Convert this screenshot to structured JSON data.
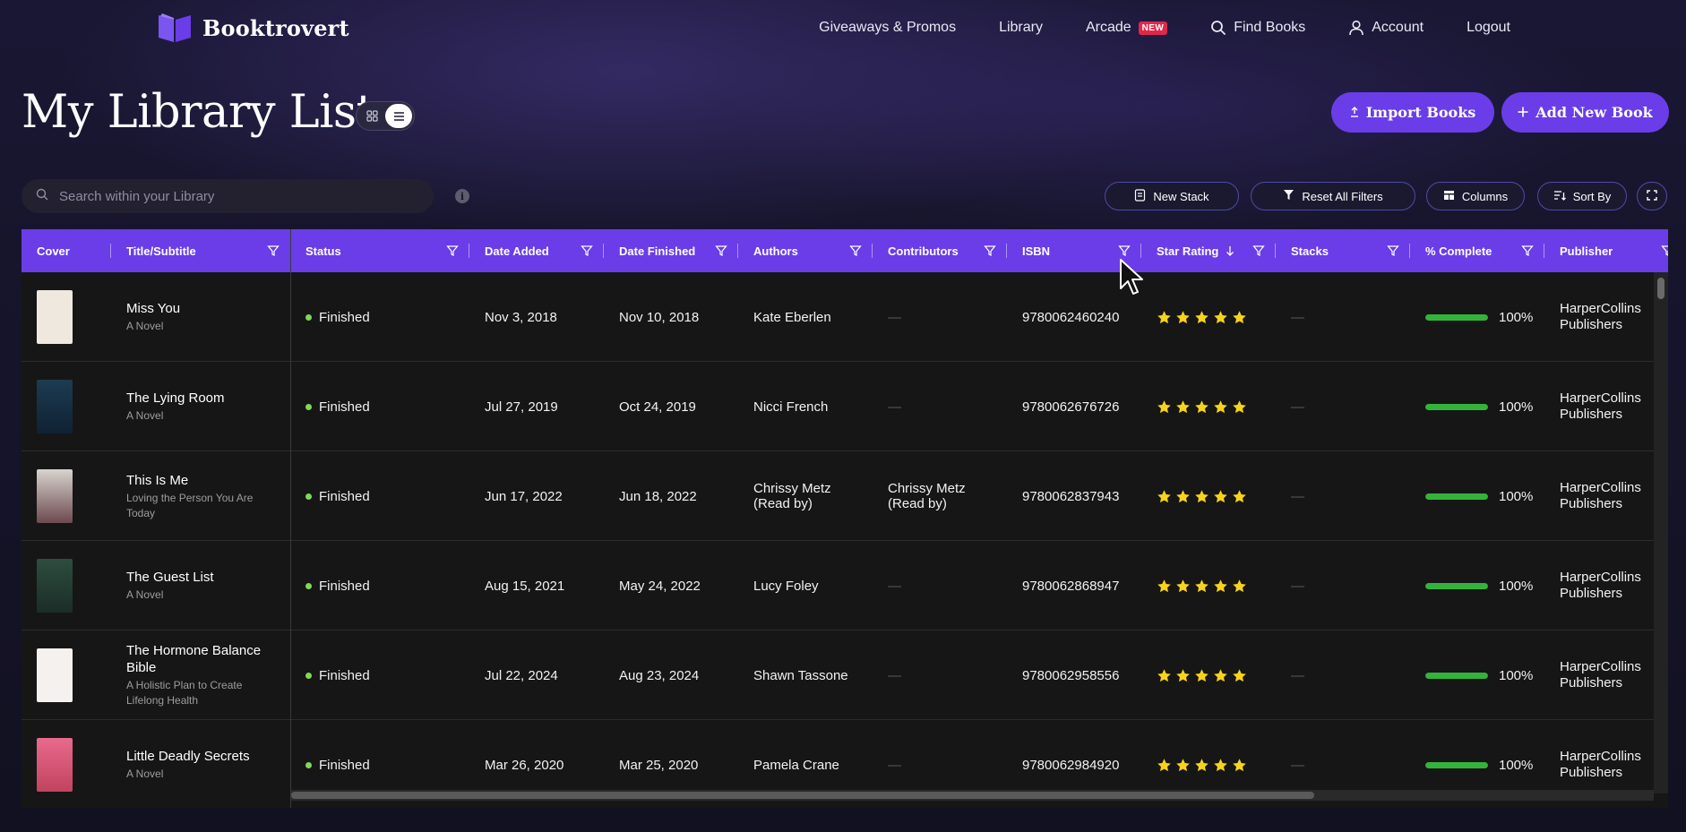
{
  "brand": {
    "name": "Booktrovert"
  },
  "nav": {
    "links": [
      {
        "label": "Giveaways & Promos"
      },
      {
        "label": "Library"
      },
      {
        "label": "Arcade",
        "badge": "NEW"
      },
      {
        "label": "Find Books",
        "icon": "search-icon"
      },
      {
        "label": "Account",
        "icon": "user-icon"
      },
      {
        "label": "Logout"
      }
    ]
  },
  "page": {
    "title": "My Library List"
  },
  "actions": {
    "import_label": "Import Books",
    "add_label": "Add New Book"
  },
  "search": {
    "placeholder": "Search within your Library"
  },
  "toolbar": {
    "new_stack": "New Stack",
    "reset_filters": "Reset All Filters",
    "columns": "Columns",
    "sort_by": "Sort By"
  },
  "colors": {
    "accent": "#6a3de8",
    "finished": "#7ed957",
    "progress": "#34b33b",
    "star": "#f7d31b",
    "badge": "#e0274a"
  },
  "table": {
    "columns": [
      "Cover",
      "Title/Subtitle",
      "Status",
      "Date Added",
      "Date Finished",
      "Authors",
      "Contributors",
      "ISBN",
      "Star Rating",
      "Stacks",
      "% Complete",
      "Publisher"
    ],
    "sorted_column": "Star Rating",
    "rows": [
      {
        "title": "Miss You",
        "subtitle": "A Novel",
        "status": "Finished",
        "date_added": "Nov 3, 2018",
        "date_finished": "Nov 10, 2018",
        "authors": "Kate Eberlen",
        "contributors": "—",
        "isbn": "9780062460240",
        "rating": 5,
        "stacks": "—",
        "complete": 100,
        "complete_label": "100%",
        "publisher": "HarperCollins Publishers"
      },
      {
        "title": "The Lying Room",
        "subtitle": "A Novel",
        "status": "Finished",
        "date_added": "Jul 27, 2019",
        "date_finished": "Oct 24, 2019",
        "authors": "Nicci French",
        "contributors": "—",
        "isbn": "9780062676726",
        "rating": 5,
        "stacks": "—",
        "complete": 100,
        "complete_label": "100%",
        "publisher": "HarperCollins Publishers"
      },
      {
        "title": "This Is Me",
        "subtitle": "Loving the Person You Are Today",
        "status": "Finished",
        "date_added": "Jun 17, 2022",
        "date_finished": "Jun 18, 2022",
        "authors": "Chrissy Metz (Read by)",
        "contributors": "Chrissy Metz (Read by)",
        "isbn": "9780062837943",
        "rating": 5,
        "stacks": "—",
        "complete": 100,
        "complete_label": "100%",
        "publisher": "HarperCollins Publishers"
      },
      {
        "title": "The Guest List",
        "subtitle": "A Novel",
        "status": "Finished",
        "date_added": "Aug 15, 2021",
        "date_finished": "May 24, 2022",
        "authors": "Lucy Foley",
        "contributors": "—",
        "isbn": "9780062868947",
        "rating": 5,
        "stacks": "—",
        "complete": 100,
        "complete_label": "100%",
        "publisher": "HarperCollins Publishers"
      },
      {
        "title": "The Hormone Balance Bible",
        "subtitle": "A Holistic Plan to Create Lifelong Health",
        "status": "Finished",
        "date_added": "Jul 22, 2024",
        "date_finished": "Aug 23, 2024",
        "authors": "Shawn Tassone",
        "contributors": "—",
        "isbn": "9780062958556",
        "rating": 5,
        "stacks": "—",
        "complete": 100,
        "complete_label": "100%",
        "publisher": "HarperCollins Publishers"
      },
      {
        "title": "Little Deadly Secrets",
        "subtitle": "A Novel",
        "status": "Finished",
        "date_added": "Mar 26, 2020",
        "date_finished": "Mar 25, 2020",
        "authors": "Pamela Crane",
        "contributors": "—",
        "isbn": "9780062984920",
        "rating": 5,
        "stacks": "—",
        "complete": 100,
        "complete_label": "100%",
        "publisher": "HarperCollins Publishers"
      }
    ]
  }
}
